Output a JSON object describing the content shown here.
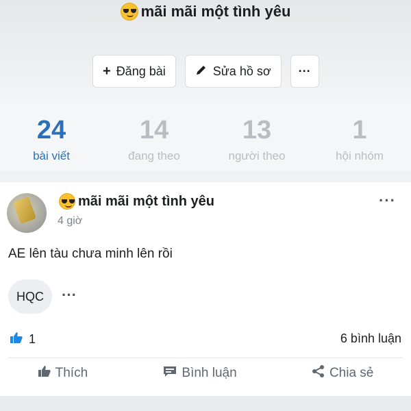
{
  "profile": {
    "name": "mãi mãi một tình yêu",
    "emoji": "smiling-face-with-sunglasses"
  },
  "actions": {
    "post_label": "Đăng bài",
    "edit_label": "Sửa hồ sơ",
    "more_label": "···"
  },
  "stats": [
    {
      "count": "24",
      "label": "bài viết"
    },
    {
      "count": "14",
      "label": "đang theo"
    },
    {
      "count": "13",
      "label": "người theo"
    },
    {
      "count": "1",
      "label": "hội nhóm"
    }
  ],
  "post": {
    "author": "mãi mãi một tình yêu",
    "time": "4 giờ",
    "content": "AE lên tàu chưa minh lên rồi",
    "tag": "HQC",
    "tag_more": "···",
    "more": "···",
    "likes": "1",
    "comments": "6 bình luận"
  },
  "post_actions": {
    "like": "Thích",
    "comment": "Bình luận",
    "share": "Chia sẻ"
  },
  "colors": {
    "accent": "#2a6fb7",
    "muted": "#b9bcc2",
    "like": "#1e88e5"
  }
}
